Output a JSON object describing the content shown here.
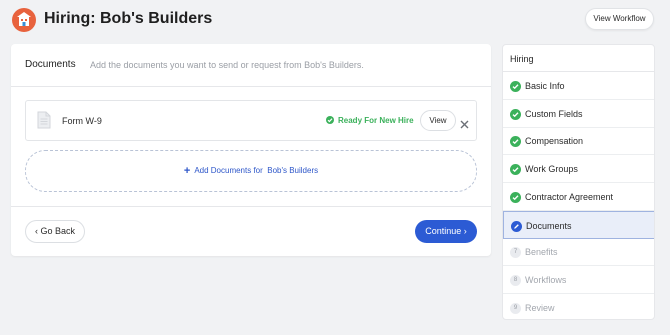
{
  "header": {
    "title": "Hiring: Bob's Builders",
    "view_workflow_label": "View Workflow"
  },
  "documents_card": {
    "title": "Documents",
    "description": "Add the documents you want to send or request from Bob's Builders.",
    "document": {
      "name": "Form W-9",
      "status": "Ready For New Hire",
      "view_label": "View"
    },
    "add_documents_label": "Add Documents for  Bob's Builders",
    "go_back_label": "Go Back",
    "continue_label": "Continue"
  },
  "sidebar": {
    "title": "Hiring",
    "steps": [
      {
        "label": "Basic Info",
        "state": "done"
      },
      {
        "label": "Custom Fields",
        "state": "done"
      },
      {
        "label": "Compensation",
        "state": "done"
      },
      {
        "label": "Work Groups",
        "state": "done"
      },
      {
        "label": "Contractor Agreement",
        "state": "done"
      },
      {
        "label": "Documents",
        "state": "active"
      },
      {
        "label": "Benefits",
        "state": "todo",
        "number": "7"
      },
      {
        "label": "Workflows",
        "state": "todo",
        "number": "8"
      },
      {
        "label": "Review",
        "state": "todo",
        "number": "9"
      }
    ]
  },
  "colors": {
    "primary": "#2c5bd4",
    "success": "#3bb15b",
    "logo": "#e8623d"
  }
}
